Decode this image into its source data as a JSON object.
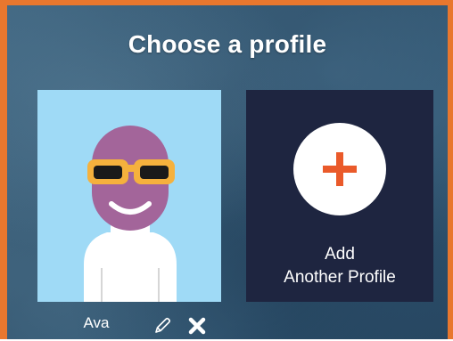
{
  "header": {
    "title": "Choose a profile"
  },
  "profiles": [
    {
      "name": "Ava",
      "avatar_icon": "avatar-sunglasses-icon",
      "actions": [
        {
          "icon": "pencil-icon",
          "action": "edit"
        },
        {
          "icon": "close-icon",
          "action": "delete"
        }
      ]
    }
  ],
  "add_profile": {
    "icon": "plus-icon",
    "label_line1": "Add",
    "label_line2": "Another Profile"
  },
  "colors": {
    "frame_border": "#e8772e",
    "background": "#345a76",
    "avatar_bg": "#9fdaf6",
    "add_card_bg": "#1e2540",
    "plus_color": "#ea5a2a",
    "avatar_head": "#a3659a",
    "avatar_glasses": "#f5b13d"
  }
}
